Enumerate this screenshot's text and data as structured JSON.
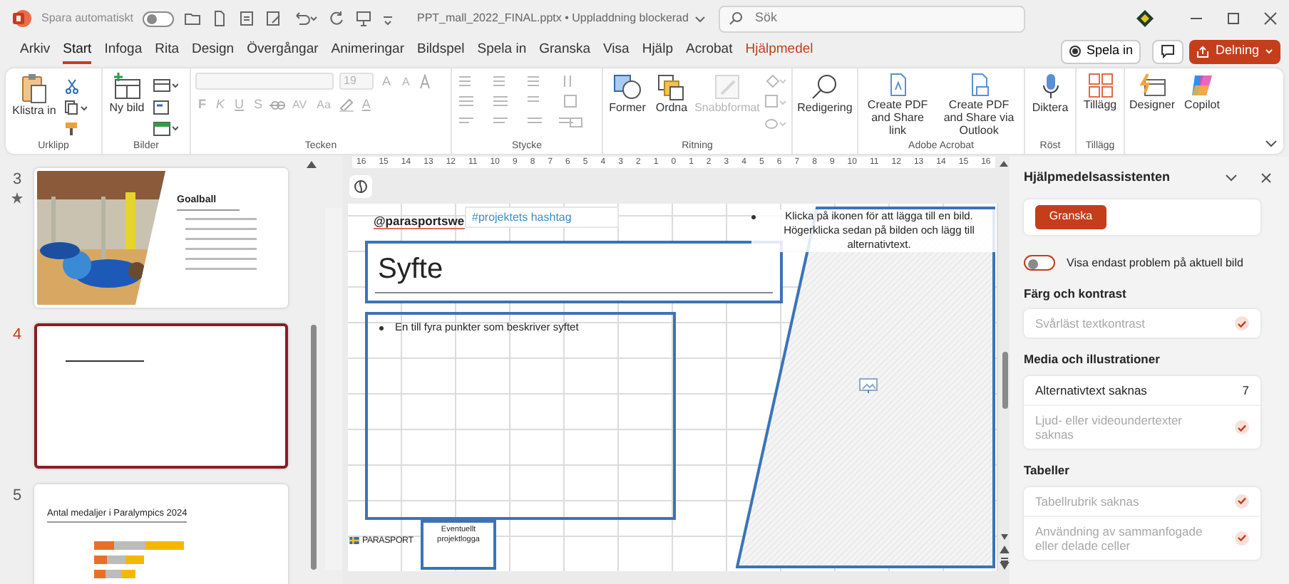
{
  "title_bar": {
    "autosave_label": "Spara automatiskt",
    "autosave_on": false,
    "document": "PPT_mall_2022_FINAL.pptx • Uppladdning blockerad",
    "search_placeholder": "Sök"
  },
  "menu_tabs": [
    {
      "label": "Arkiv",
      "selected": false,
      "kind": "normal"
    },
    {
      "label": "Start",
      "selected": true,
      "kind": "normal"
    },
    {
      "label": "Infoga",
      "selected": false,
      "kind": "normal"
    },
    {
      "label": "Rita",
      "selected": false,
      "kind": "normal"
    },
    {
      "label": "Design",
      "selected": false,
      "kind": "normal"
    },
    {
      "label": "Övergångar",
      "selected": false,
      "kind": "normal"
    },
    {
      "label": "Animeringar",
      "selected": false,
      "kind": "normal"
    },
    {
      "label": "Bildspel",
      "selected": false,
      "kind": "normal"
    },
    {
      "label": "Spela in",
      "selected": false,
      "kind": "normal"
    },
    {
      "label": "Granska",
      "selected": false,
      "kind": "normal"
    },
    {
      "label": "Visa",
      "selected": false,
      "kind": "normal"
    },
    {
      "label": "Hjälp",
      "selected": false,
      "kind": "normal"
    },
    {
      "label": "Acrobat",
      "selected": false,
      "kind": "normal"
    },
    {
      "label": "Hjälpmedel",
      "selected": false,
      "kind": "contextual"
    }
  ],
  "header_buttons": {
    "record": "Spela in",
    "share": "Delning"
  },
  "ribbon": {
    "paste": "Klistra in",
    "new_slide": "Ny bild",
    "font_size": "19",
    "grow": "A",
    "shrink": "A",
    "bold": "F",
    "italic": "K",
    "underline": "U",
    "shadow": "S",
    "spacing": "AV",
    "case": "Aa",
    "font_color": "A",
    "formatting_disabled": true,
    "shapes": "Former",
    "arrange": "Ordna",
    "quick_styles": "Snabbformat",
    "quick_styles_disabled": true,
    "editing": "Redigering",
    "pdf_link": "Create PDF and Share link",
    "pdf_outlook": "Create PDF and Share via Outlook",
    "dictate": "Diktera",
    "addins": "Tillägg",
    "designer": "Designer",
    "copilot": "Copilot",
    "groups": [
      "Urklipp",
      "Bilder",
      "Tecken",
      "Stycke",
      "Ritning",
      "Adobe Acrobat",
      "Röst",
      "Tillägg"
    ]
  },
  "thumbnails": [
    {
      "number": "3",
      "selected": false,
      "title": "Goalball"
    },
    {
      "number": "4",
      "selected": true,
      "kind": "blank"
    },
    {
      "number": "5",
      "selected": false,
      "kind": "chart",
      "title": "Antal medaljer i Paralympics 2024"
    }
  ],
  "ruler_labels": [
    "16",
    "15",
    "14",
    "13",
    "12",
    "11",
    "10",
    "9",
    "8",
    "7",
    "6",
    "5",
    "4",
    "3",
    "2",
    "1",
    "0",
    "1",
    "2",
    "3",
    "4",
    "5",
    "6",
    "7",
    "8",
    "9",
    "10",
    "11",
    "12",
    "13",
    "14",
    "15",
    "16"
  ],
  "slide": {
    "handle": "@parasportswe",
    "hashtag": "#projektets hashtag",
    "title": "Syfte",
    "bullets": [
      "En till fyra punkter som beskriver syftet"
    ],
    "picture_prompt": "Klicka på ikonen för att lägga till en bild. Högerklicka sedan på bilden och lägg till alternativtext.",
    "logo": "PARASPORT",
    "logo_placeholder": "Eventuellt projektlogga"
  },
  "pane": {
    "title": "Hjälpmedelsassistenten",
    "review_button": "Granska",
    "filter_label": "Visa endast problem på aktuell bild",
    "filter_on": false,
    "sections": [
      {
        "heading": "Färg och kontrast",
        "items": [
          {
            "label": "Svårläst textkontrast",
            "resolved": true
          }
        ]
      },
      {
        "heading": "Media och illustrationer",
        "items": [
          {
            "label": "Alternativtext saknas",
            "resolved": false,
            "count": "7"
          },
          {
            "label": "Ljud- eller videoundertexter saknas",
            "resolved": true
          }
        ]
      },
      {
        "heading": "Tabeller",
        "items": [
          {
            "label": "Tabellrubrik saknas",
            "resolved": true
          },
          {
            "label": "Användning av sammanfogade eller delade celler",
            "resolved": true
          }
        ]
      }
    ]
  }
}
